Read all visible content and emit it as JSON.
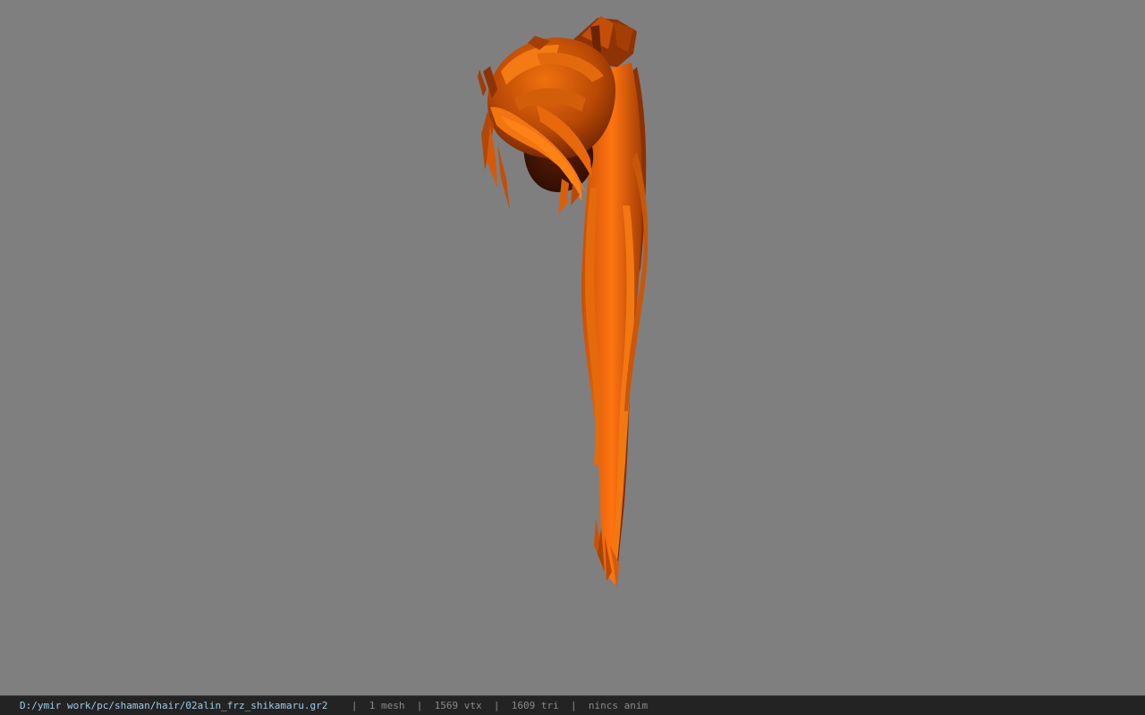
{
  "viewer": {
    "background_color": "#7f7f7f",
    "model_base_color": "#d9600a",
    "model_dark_color": "#5a1e04",
    "model_light_color": "#ff7a12"
  },
  "status_bar": {
    "file_path": "D:/ymir work/pc/shaman/hair/02alin_frz_shikamaru.gr2",
    "separator": "|",
    "mesh_count": "1 mesh",
    "vertex_count": "1569 vtx",
    "triangle_count": "1609 tri",
    "anim_status": "nincs anim",
    "path_color": "#9ecde8",
    "text_color": "#8a8a8a",
    "background_color": "#232323"
  }
}
